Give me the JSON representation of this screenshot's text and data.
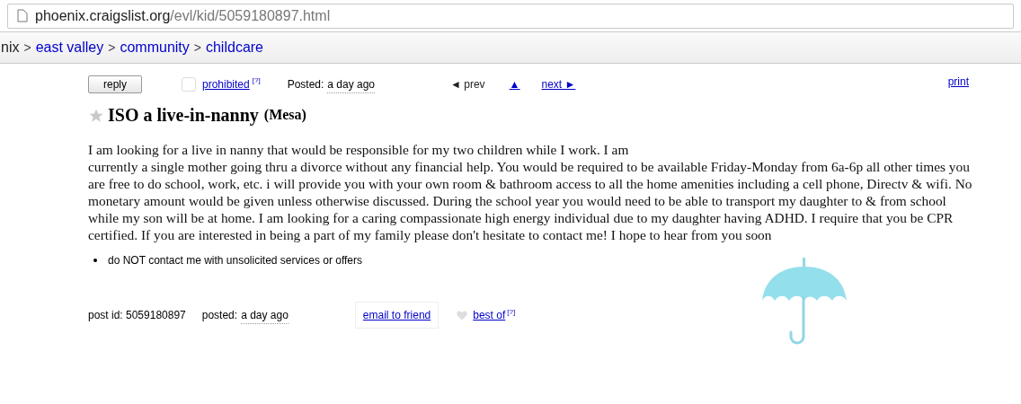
{
  "address_bar": {
    "host": "phoenix.craigslist.org",
    "path": "/evl/kid/5059180897.html"
  },
  "breadcrumbs": [
    {
      "label": "nix",
      "link": false
    },
    {
      "label": "east valley",
      "link": true
    },
    {
      "label": "community",
      "link": true
    },
    {
      "label": "childcare",
      "link": true
    }
  ],
  "breadcrumb_separator": ">",
  "toolbar": {
    "reply": "reply",
    "flagged": false,
    "prohibited": "prohibited",
    "help_mark": "[?]",
    "posted_label": "Posted:",
    "posted_value": "a day ago",
    "prev": "◄ prev",
    "prev_enabled": false,
    "up": "▲",
    "next": "next ►",
    "next_enabled": true,
    "print": "print"
  },
  "title": {
    "text": "ISO a live-in-nanny",
    "location": "(Mesa)",
    "favorited": false
  },
  "body_lines": [
    "I am looking for a live in nanny that would be responsible for my two children while I work. I am",
    "currently a single mother going thru a divorce without any financial help. You would be required to be available Friday-Monday from 6a-6p all other times you are free to do school, work, etc. i will provide you with your own room & bathroom access to all the home amenities including a cell phone, Directv & wifi. No monetary amount would be given unless otherwise discussed. During the school year you would need to be able to transport my daughter to & from school while my son will be at home. I am looking for a caring compassionate high energy individual due to my daughter having ADHD. I require that you be CPR certified. If you are interested in being a part of my family please don't hesitate to contact me! I hope to hear from you soon"
  ],
  "notices": [
    "do NOT contact me with unsolicited services or offers"
  ],
  "footer": {
    "post_id": "post id: 5059180897",
    "posted_label": "posted:",
    "posted_value": "a day ago",
    "email": "email to friend",
    "best_of": "best of",
    "help_mark": "[?]",
    "liked": false
  }
}
